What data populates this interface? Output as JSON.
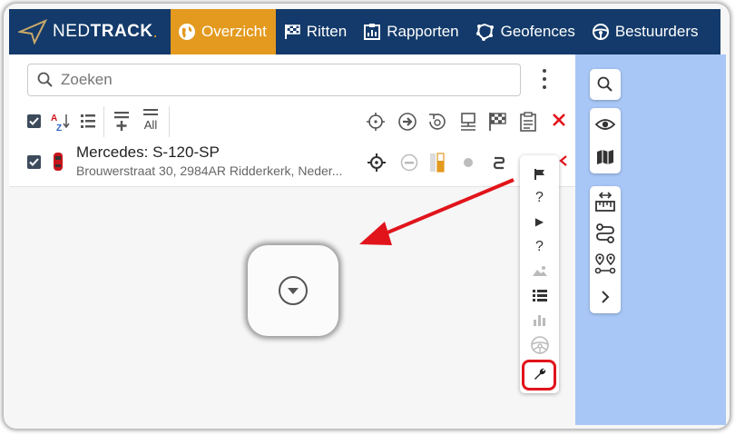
{
  "brand": {
    "name_light": "NED",
    "name_bold": "TRACK",
    "dot": "."
  },
  "nav": [
    {
      "label": "Overzicht",
      "icon": "globe-icon",
      "active": true
    },
    {
      "label": "Ritten",
      "icon": "checkered-flag-icon",
      "active": false
    },
    {
      "label": "Rapporten",
      "icon": "report-icon",
      "active": false
    },
    {
      "label": "Geofences",
      "icon": "geofence-icon",
      "active": false
    },
    {
      "label": "Bestuurders",
      "icon": "steering-wheel-icon",
      "active": false
    }
  ],
  "search": {
    "placeholder": "Zoeken"
  },
  "toolbar": {
    "left": [
      "select-all-checkbox",
      "sort-az-icon",
      "list-icon",
      "add-icon",
      "all-icon"
    ],
    "all_label": "All",
    "right": [
      "locate-icon",
      "forward-icon",
      "replay-icon",
      "device-icon",
      "checkered-flag-icon",
      "clipboard-icon",
      "close-icon"
    ]
  },
  "vehicle": {
    "name": "Mercedes: S-120-SP",
    "address": "Brouwerstraat 30, 2984AR Ridderkerk, Neder..."
  },
  "popup_menu": [
    {
      "icon": "flag-icon",
      "text": "⚑",
      "dim": false
    },
    {
      "icon": "unknown-icon",
      "text": "?",
      "dim": false
    },
    {
      "icon": "play-icon",
      "text": "▶",
      "dim": false
    },
    {
      "icon": "unknown-icon",
      "text": "?",
      "dim": false
    },
    {
      "icon": "image-icon",
      "text": "",
      "dim": true
    },
    {
      "icon": "list-icon",
      "text": "",
      "dim": false
    },
    {
      "icon": "bar-chart-icon",
      "text": "",
      "dim": true
    },
    {
      "icon": "steering-wheel-icon",
      "text": "",
      "dim": true
    },
    {
      "icon": "wrench-icon",
      "text": "",
      "dim": false
    }
  ],
  "right_tools": [
    "search-icon",
    "eye-icon",
    "map-icon",
    "ruler-icon",
    "route-icon",
    "waypoints-icon",
    "chevron-right-icon"
  ],
  "colors": {
    "navbar": "#133a6a",
    "accent": "#e39a1f",
    "map": "#a8c7f6",
    "highlight": "#e1141b"
  }
}
